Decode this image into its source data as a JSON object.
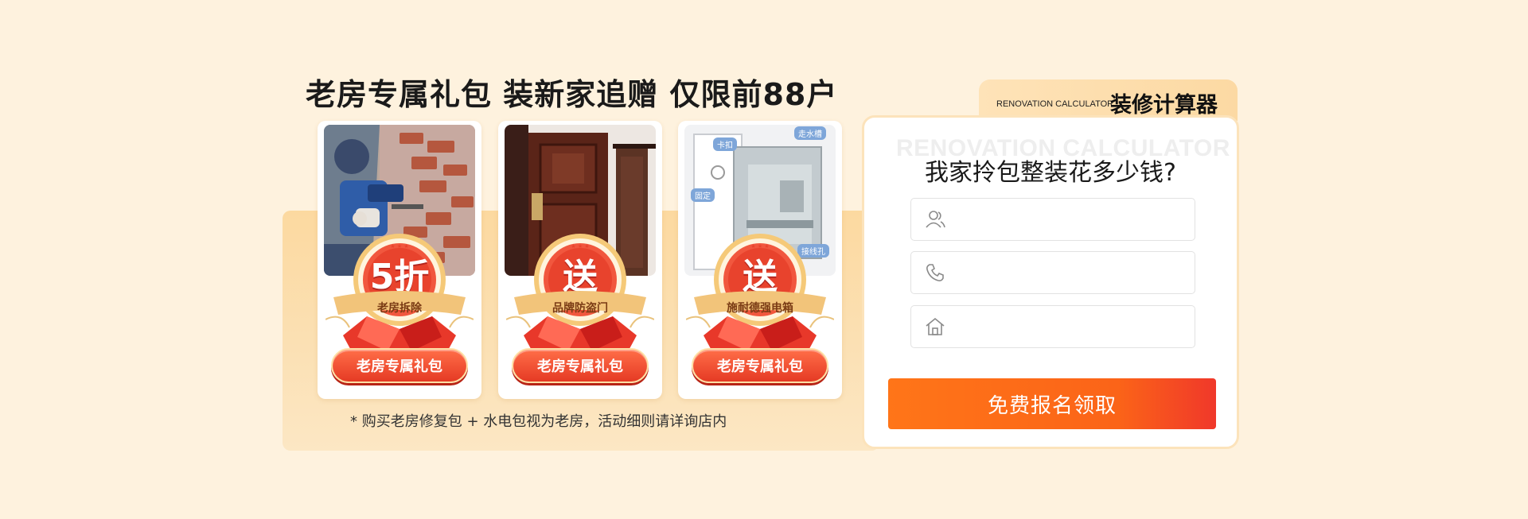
{
  "headline": "老房专属礼包 装新家追赠 仅限前88户",
  "cards": [
    {
      "badge_big": "5折",
      "badge_label": "老房拆除",
      "button": "老房专属礼包",
      "photo": "demolition-photo"
    },
    {
      "badge_big": "送",
      "badge_label": "品牌防盗门",
      "button": "老房专属礼包",
      "photo": "security-door-photo"
    },
    {
      "badge_big": "送",
      "badge_label": "施耐德强电箱",
      "button": "老房专属礼包",
      "photo": "electric-box-photo",
      "photo_tags": [
        "卡扣",
        "走水槽",
        "固定",
        "接线孔"
      ]
    }
  ],
  "footnote": "* 购买老房修复包 + 水电包视为老房，活动细则请详询店内",
  "calculator": {
    "tab_en": "RENOVATION CALCULATOR",
    "tab_zh": "装修计算器",
    "watermark": "RENOVATION CALCULATOR",
    "question": "我家拎包整装花多少钱?",
    "fields": [
      {
        "icon": "user-icon",
        "value": "",
        "placeholder": ""
      },
      {
        "icon": "phone-icon",
        "value": "",
        "placeholder": ""
      },
      {
        "icon": "house-icon",
        "value": "",
        "placeholder": ""
      }
    ],
    "submit": "免费报名领取"
  },
  "colors": {
    "page_bg": "#FEF2DE",
    "panel": "#FCD9A0",
    "accent_red": "#E53A24",
    "accent_orange": "#FF7518",
    "gold": "#F2B867"
  }
}
